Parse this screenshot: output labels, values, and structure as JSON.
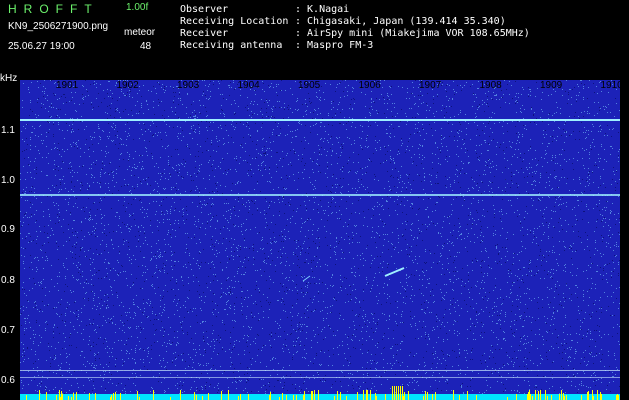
{
  "header": {
    "app_title": "HROFFT",
    "app_version": "1.00f",
    "filename": "KN9_2506271900.png",
    "unit": "meteor",
    "timestamp": "25.06.27 19:00",
    "count": "48"
  },
  "info": {
    "rows": [
      {
        "label": "Observer",
        "value": ": K.Nagai"
      },
      {
        "label": "Receiving Location",
        "value": ": Chigasaki, Japan (139.414 35.340)"
      },
      {
        "label": "Receiver",
        "value": ": AirSpy mini (Miakejima VOR 108.65MHz)"
      },
      {
        "label": "Receiving antenna",
        "value": ": Maspro FM-3"
      }
    ]
  },
  "spectrogram": {
    "y_unit": "kHz",
    "time_ticks": [
      "1901",
      "1902",
      "1903",
      "1904",
      "1905",
      "1906",
      "1907",
      "1908",
      "1909",
      "1910"
    ],
    "freq_ticks": [
      "1.1",
      "1.0",
      "0.9",
      "0.8",
      "0.7",
      "0.6"
    ],
    "background_color": "#1c22b8",
    "noise_color": "#7fd0ff",
    "line_color": "#9ff0ff",
    "baseline_color": "#00e5ff",
    "spike_color": "#ffff00"
  }
}
